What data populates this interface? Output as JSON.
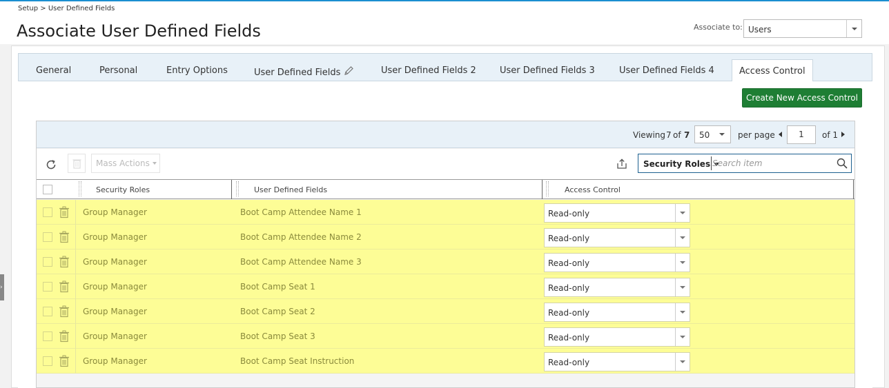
{
  "breadcrumb": "Setup > User Defined Fields",
  "page_title": "Associate User Defined Fields",
  "associate": {
    "label": "Associate to:",
    "value": "Users"
  },
  "tabs": [
    {
      "label": "General"
    },
    {
      "label": "Personal"
    },
    {
      "label": "Entry Options"
    },
    {
      "label": "User Defined Fields"
    },
    {
      "label": "User Defined Fields 2"
    },
    {
      "label": "User Defined Fields 3"
    },
    {
      "label": "User Defined Fields 4"
    },
    {
      "label": "Access Control"
    }
  ],
  "create_button": "Create New Access Control",
  "pager": {
    "viewing": "Viewing",
    "shown": "7",
    "of_word": "of",
    "total": "7",
    "per_page_value": "50",
    "per_page_label": "per page",
    "page": "1",
    "of_pages": "of 1"
  },
  "toolbar": {
    "mass_actions": "Mass Actions",
    "search_scope": "Security Roles",
    "search_placeholder": "Search item"
  },
  "columns": [
    "Security Roles",
    "User Defined Fields",
    "Access Control"
  ],
  "rows": [
    {
      "role": "Group Manager",
      "field": "Boot Camp Attendee Name 1",
      "access": "Read-only"
    },
    {
      "role": "Group Manager",
      "field": "Boot Camp Attendee Name 2",
      "access": "Read-only"
    },
    {
      "role": "Group Manager",
      "field": "Boot Camp Attendee Name 3",
      "access": "Read-only"
    },
    {
      "role": "Group Manager",
      "field": "Boot Camp Seat 1",
      "access": "Read-only"
    },
    {
      "role": "Group Manager",
      "field": "Boot Camp Seat 2",
      "access": "Read-only"
    },
    {
      "role": "Group Manager",
      "field": "Boot Camp Seat 3",
      "access": "Read-only"
    },
    {
      "role": "Group Manager",
      "field": "Boot Camp Seat Instruction",
      "access": "Read-only"
    }
  ],
  "colors": {
    "accent": "#1b8fd0",
    "create_button": "#1e7e34",
    "row_highlight": "#fdfd96",
    "tabbar": "#e8f1f8"
  },
  "icons": [
    "pencil-icon",
    "refresh-icon",
    "trash-icon",
    "export-icon",
    "search-icon",
    "chevron-right-icon"
  ]
}
